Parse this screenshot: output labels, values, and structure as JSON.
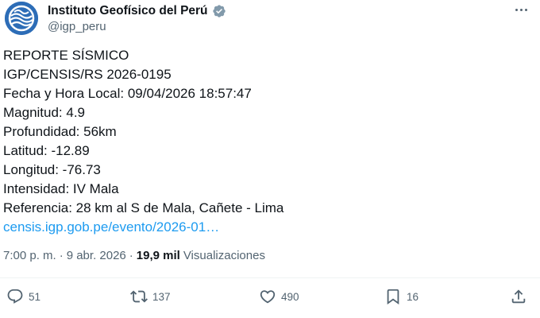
{
  "author": {
    "display_name": "Instituto Geofísico del Perú",
    "handle": "@igp_peru"
  },
  "icons": {
    "avatar": "igp-logo-icon",
    "verified": "verified-badge-icon",
    "more": "more-dots-icon",
    "reply": "reply-icon",
    "retweet": "retweet-icon",
    "like": "heart-icon",
    "bookmark": "bookmark-icon",
    "share": "share-icon"
  },
  "colors": {
    "accent": "#1d9bf0",
    "text": "#0f1419",
    "secondary": "#536471",
    "avatar_bg": "#2d6db7"
  },
  "tweet": {
    "lines": [
      "REPORTE SÍSMICO",
      "IGP/CENSIS/RS 2026-0195",
      "Fecha y Hora Local: 09/04/2026 18:57:47",
      "Magnitud: 4.9",
      "Profundidad: 56km",
      "Latitud: -12.89",
      "Longitud: -76.73",
      "Intensidad: IV Mala",
      "Referencia: 28 km al S de Mala, Cañete - Lima"
    ],
    "link": "censis.igp.gob.pe/evento/2026-01…"
  },
  "meta": {
    "time": "7:00 p. m.",
    "separator": "·",
    "date": "9 abr. 2026",
    "views_count": "19,9 mil",
    "views_label": "Visualizaciones"
  },
  "actions": {
    "replies": "51",
    "retweets": "137",
    "likes": "490",
    "bookmarks": "16"
  }
}
